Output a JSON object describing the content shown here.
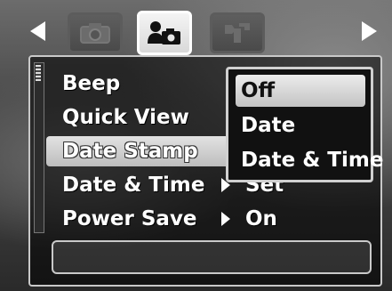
{
  "tabs": {
    "left_arrow": "previous-tab",
    "right_arrow": "next-tab",
    "items": [
      {
        "icon": "camera-icon",
        "active": false
      },
      {
        "icon": "person-camera-icon",
        "active": true
      },
      {
        "icon": "wrench-icon",
        "active": false
      }
    ]
  },
  "menu": {
    "items": [
      {
        "label": "Beep",
        "value": ""
      },
      {
        "label": "Quick View",
        "value": ""
      },
      {
        "label": "Date Stamp",
        "value": ""
      },
      {
        "label": "Date & Time",
        "value": "Set"
      },
      {
        "label": "Power Save",
        "value": "On"
      }
    ],
    "selected_index": 2
  },
  "popup": {
    "options": [
      "Off",
      "Date",
      "Date & Time"
    ],
    "selected_index": 0
  },
  "colors": {
    "highlight": "#d6d6d6",
    "text": "#ffffff"
  }
}
